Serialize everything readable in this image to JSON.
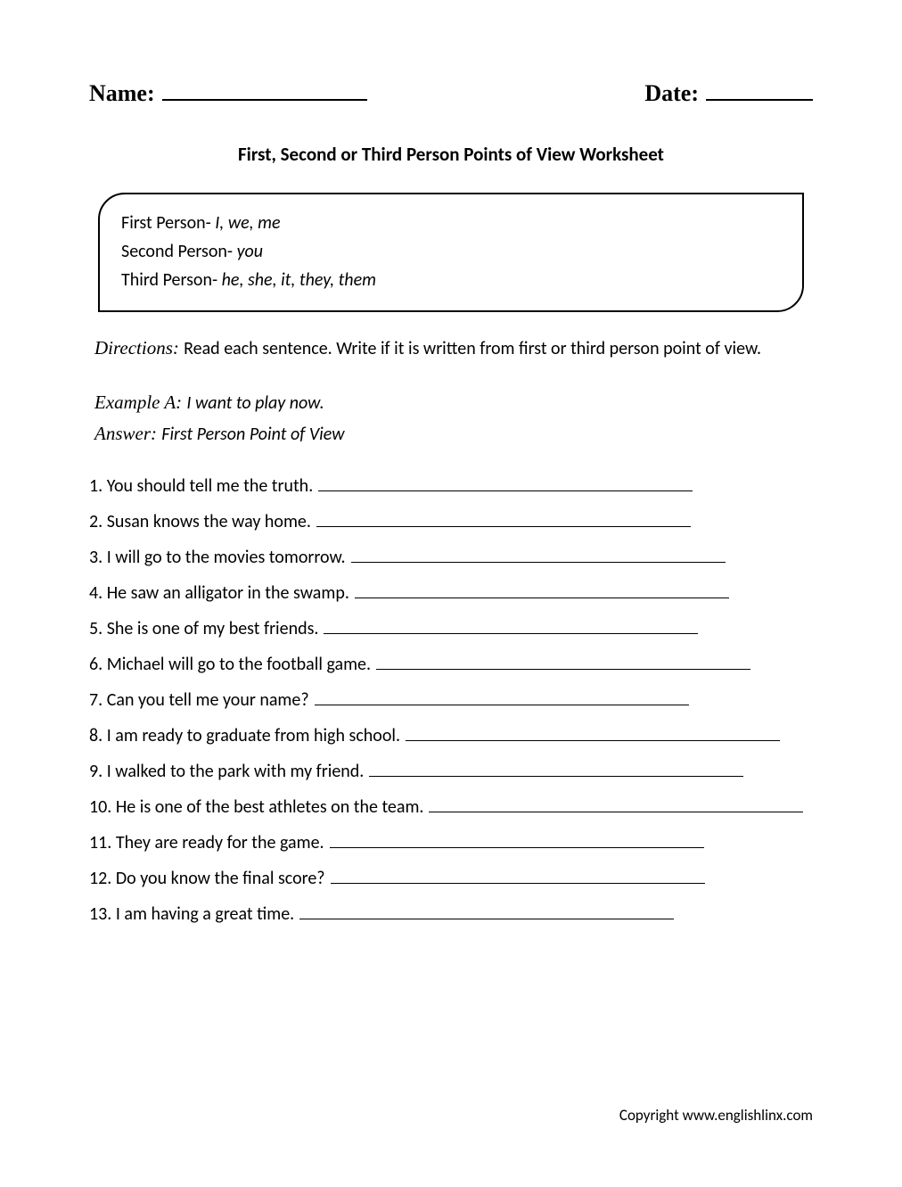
{
  "header": {
    "name_label": "Name:",
    "date_label": "Date:"
  },
  "title": "First, Second or Third Person Points of View Worksheet",
  "info": [
    {
      "label": "First Person- ",
      "examples": "I, we, me"
    },
    {
      "label": "Second Person- ",
      "examples": "you"
    },
    {
      "label": "Third Person- ",
      "examples": "he, she, it, they, them"
    }
  ],
  "directions": {
    "label": "Directions: ",
    "text": "Read each sentence. Write if it is written from first or third person point of view."
  },
  "example": {
    "label": "Example A: ",
    "text": "I want to play now.",
    "answer_label": "Answer: ",
    "answer_text": "First Person Point of View"
  },
  "questions": [
    "1. You should tell me the truth.",
    "2. Susan knows the way home.",
    "3. I will go to the movies tomorrow.",
    "4. He saw an alligator in the swamp.",
    "5. She is one of my best friends.",
    "6. Michael will go to the football game.",
    "7. Can you tell me your name?",
    "8. I am ready to graduate from high school.",
    "9. I walked to the park with my friend.",
    "10. He is one of the best athletes on the team.",
    "11. They are ready for the game.",
    "12. Do you know the final score?",
    "13. I am having a great time."
  ],
  "copyright": "Copyright www.englishlinx.com"
}
